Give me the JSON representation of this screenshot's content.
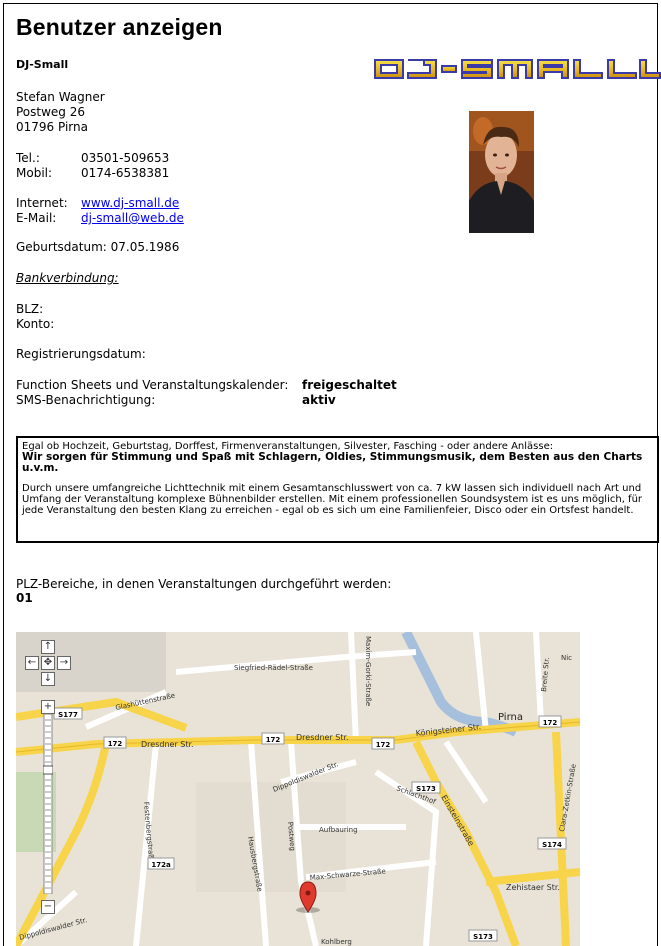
{
  "page": {
    "title": "Benutzer anzeigen"
  },
  "profile": {
    "name_heading": "DJ-Small",
    "logo_text": "DJ-SMALL",
    "person": "Stefan Wagner",
    "street": "Postweg 26",
    "city": "01796 Pirna",
    "tel_label": "Tel.:",
    "tel_value": "03501-509653",
    "mobil_label": "Mobil:",
    "mobil_value": "0174-6538381",
    "internet_label": "Internet:",
    "internet_value": "www.dj-small.de",
    "email_label": "E-Mail:",
    "email_value": "dj-small@web.de",
    "birthdate": "Geburtsdatum: 07.05.1986",
    "bank_heading": "Bankverbindung:",
    "blz_label": "BLZ:",
    "konto_label": "Konto:",
    "registration": "Registrierungsdatum:",
    "function_label": "Function Sheets und Veranstaltungskalender:",
    "function_value": "freigeschaltet",
    "sms_label": "SMS-Benachrichtigung:",
    "sms_value": "aktiv"
  },
  "description": {
    "line1": "Egal ob Hochzeit, Geburtstag, Dorffest, Firmenveranstaltungen, Silvester, Fasching - oder andere Anlässe:",
    "line2": "Wir sorgen für Stimmung und Spaß mit Schlagern, Oldies, Stimmungsmusik, dem Besten aus den Charts u.v.m.",
    "line3": "Durch unsere umfangreiche Lichttechnik mit einem Gesamtanschlusswert von ca. 7 kW lassen sich individuell nach Art und Umfang der Veranstaltung komplexe Bühnenbilder erstellen. Mit einem professionellen Soundsystem ist es uns möglich, für jede Veranstaltung den besten Klang zu erreichen - egal ob es sich um eine Familienfeier, Disco oder ein Ortsfest handelt."
  },
  "plz": {
    "label": "PLZ-Bereiche, in denen Veranstaltungen durchgeführt werden:",
    "value": "01"
  },
  "map": {
    "labels": {
      "siegfried": "Siegfried-Rädel-Straße",
      "glashutten": "Glashüttenstraße",
      "dresdner1": "Dresdner Str.",
      "dresdner2": "Dresdner Str.",
      "maxim": "Maxim-Gorki-Straße",
      "konigsteiner": "Königsteiner Str.",
      "pirna": "Pirna",
      "dippoldiswalder": "Dippoldiswalder Str.",
      "schlachthof": "Schlachthof",
      "aufbauring": "Aufbauring",
      "festenberg": "Festenbergstraße",
      "hausberg": "Hausbergstraße",
      "postweg": "Postweg",
      "max_schwarze": "Max-Schwarze-Straße",
      "einsteinstr": "Einsteinstraße",
      "zehista": "Zehistaer Str.",
      "clara": "Clara-Zetkin-Straße",
      "breite": "Breite Str.",
      "dippold2": "Dippoldiswalder Str.",
      "kohl": "Kohlberg",
      "nic": "Nic",
      "route_172": "172",
      "route_172a": "172a",
      "route_s177": "S177",
      "route_s173": "S173",
      "route_s174": "S174"
    },
    "controls": {
      "up": "↑",
      "left": "←",
      "center": "✥",
      "right": "→",
      "down": "↓",
      "zoom_in": "+",
      "zoom_out": "−"
    },
    "colors": {
      "land": "#e8e3d6",
      "road_major": "#f8d44a",
      "road_minor": "#ffffff",
      "water": "#a6bfdd",
      "marker": "#e03a2e"
    }
  }
}
